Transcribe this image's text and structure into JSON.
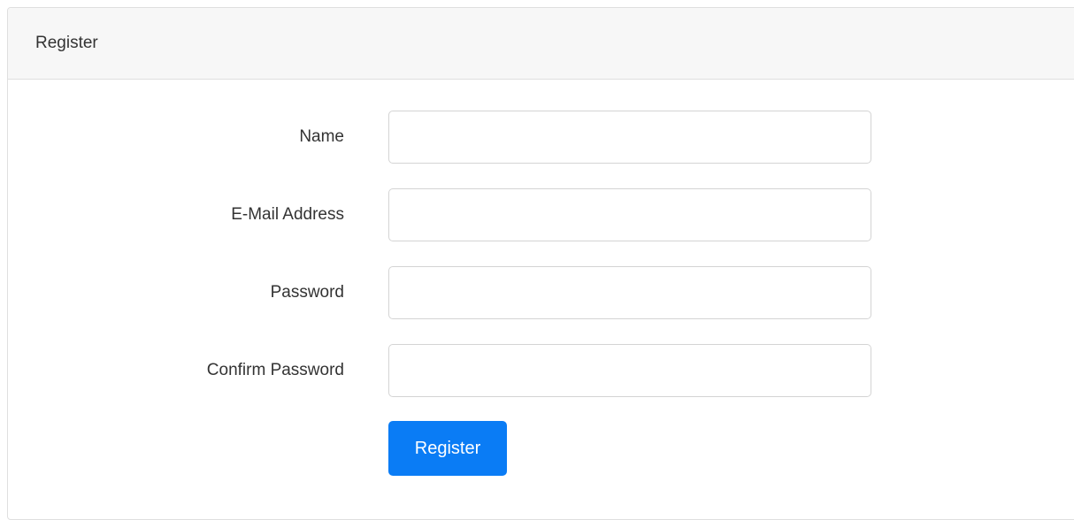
{
  "card": {
    "title": "Register"
  },
  "form": {
    "fields": [
      {
        "label": "Name",
        "value": "",
        "type": "text"
      },
      {
        "label": "E-Mail Address",
        "value": "",
        "type": "email"
      },
      {
        "label": "Password",
        "value": "",
        "type": "password"
      },
      {
        "label": "Confirm Password",
        "value": "",
        "type": "password"
      }
    ],
    "submit_label": "Register"
  },
  "colors": {
    "primary": "#0a7cf5",
    "header_bg": "#f7f7f7",
    "border": "#dfdfdf"
  }
}
